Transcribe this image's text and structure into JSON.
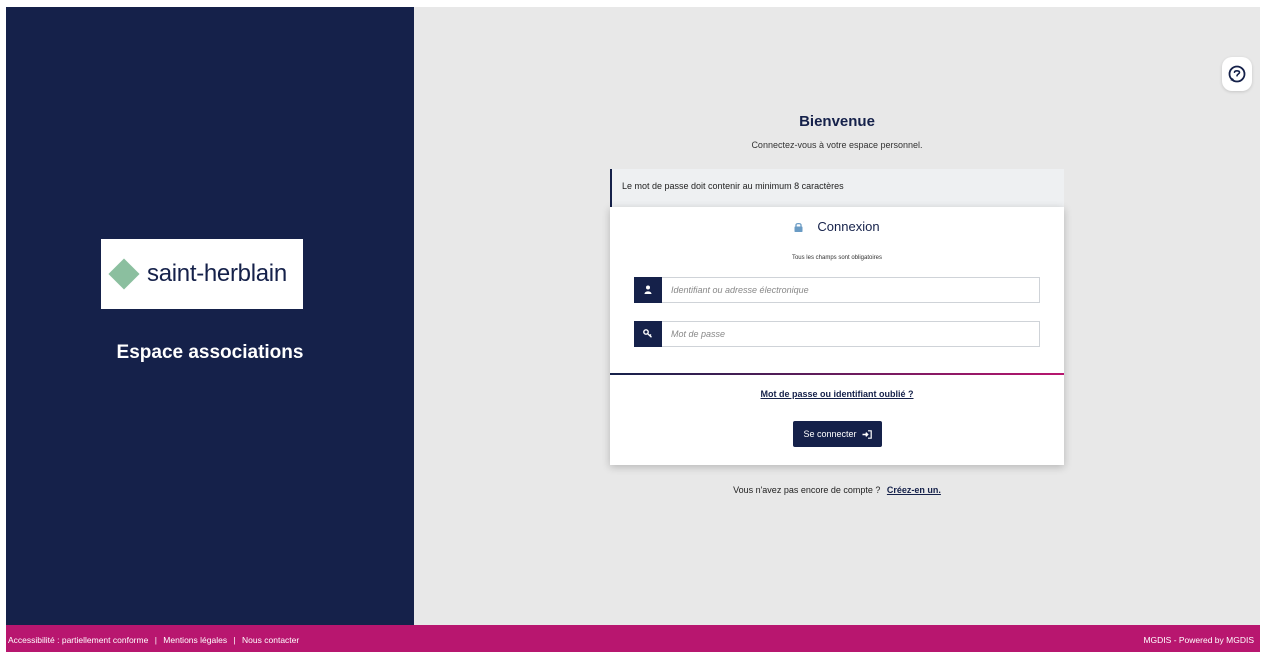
{
  "brand": {
    "logo_text": "saint-herblain",
    "space_title": "Espace associations"
  },
  "main": {
    "welcome_title": "Bienvenue",
    "welcome_subtitle": "Connectez-vous à votre espace personnel.",
    "password_notice": "Le mot de passe doit contenir au minimum 8 caractères",
    "no_account_text": "Vous n'avez pas encore de compte ?",
    "create_account_link": "Créez-en un."
  },
  "login": {
    "title": "Connexion",
    "required_note": "Tous les champs sont obligatoires",
    "username_placeholder": "Identifiant ou adresse électronique",
    "password_placeholder": "Mot de passe",
    "forgot_link": "Mot de passe ou identifiant oublié ?",
    "submit_label": "Se connecter"
  },
  "footer": {
    "accessibility": "Accessibilité : partiellement conforme",
    "legal": "Mentions légales",
    "contact": "Nous contacter",
    "powered": "MGDIS - Powered by MGDIS",
    "separator": "|"
  },
  "icons": {
    "help": "help-bubble-icon",
    "lock": "lock-icon",
    "user": "user-icon",
    "key": "key-icon",
    "login": "sign-in-icon"
  },
  "colors": {
    "navy": "#15214a",
    "magenta": "#b8166f",
    "logo_green": "#8bbf9f",
    "background": "#e8e8e8"
  }
}
